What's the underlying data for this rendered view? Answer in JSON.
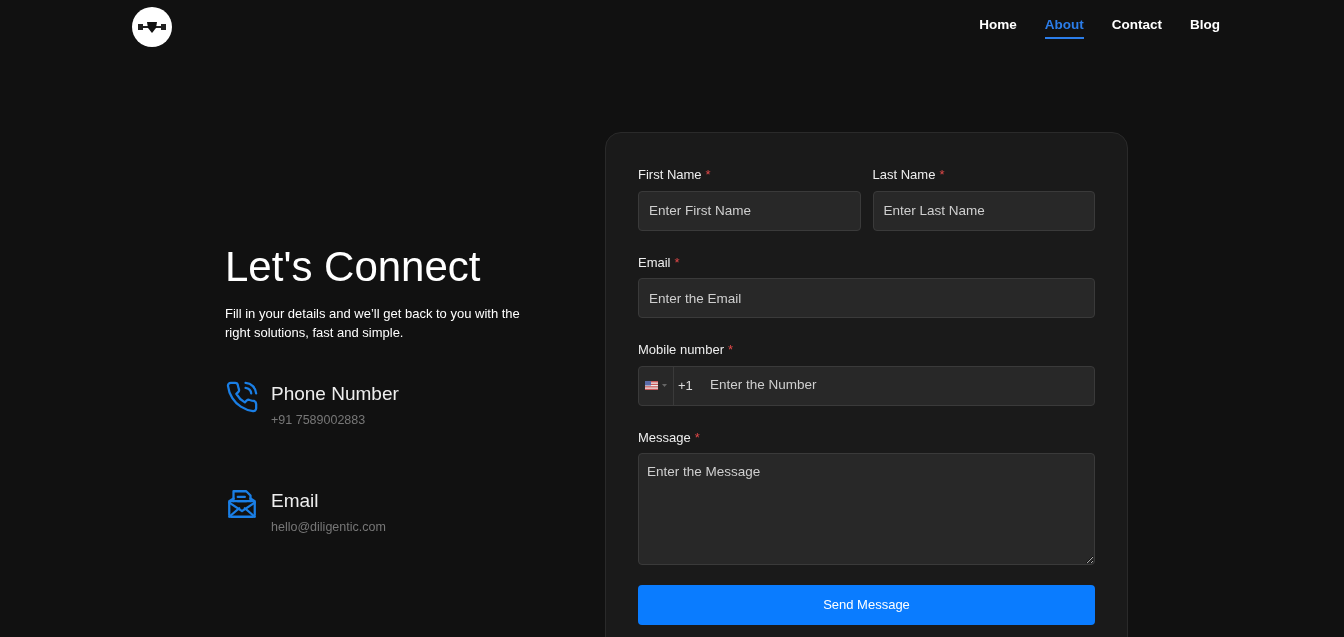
{
  "nav": {
    "items": [
      {
        "label": "Home",
        "selected": false
      },
      {
        "label": "About",
        "selected": true
      },
      {
        "label": "Contact",
        "selected": false
      },
      {
        "label": "Blog",
        "selected": false
      }
    ]
  },
  "intro": {
    "title": "Let's Connect",
    "text": "Fill in your details and we’ll get back to you with the right solutions, fast and simple.",
    "contacts": [
      {
        "kind": "phone",
        "title": "Phone Number",
        "value": "+91 7589002883"
      },
      {
        "kind": "email",
        "title": "Email",
        "value": "hello@diligentic.com"
      }
    ]
  },
  "form": {
    "rows": [
      [
        {
          "kind": "text",
          "label": "First Name",
          "required_mark": "*",
          "placeholder": "Enter First Name"
        },
        {
          "kind": "text",
          "label": "Last Name",
          "required_mark": "*",
          "placeholder": "Enter Last Name"
        }
      ],
      [
        {
          "kind": "text",
          "label": "Email",
          "required_mark": "*",
          "placeholder": "Enter the Email"
        }
      ],
      [
        {
          "kind": "phone",
          "label": "Mobile number",
          "required_mark": "*",
          "dial_code": "+1",
          "placeholder": "Enter the Number"
        }
      ],
      [
        {
          "kind": "textarea",
          "label": "Message",
          "required_mark": "*",
          "placeholder": "Enter the Message"
        }
      ]
    ],
    "submit": "Send Message"
  }
}
